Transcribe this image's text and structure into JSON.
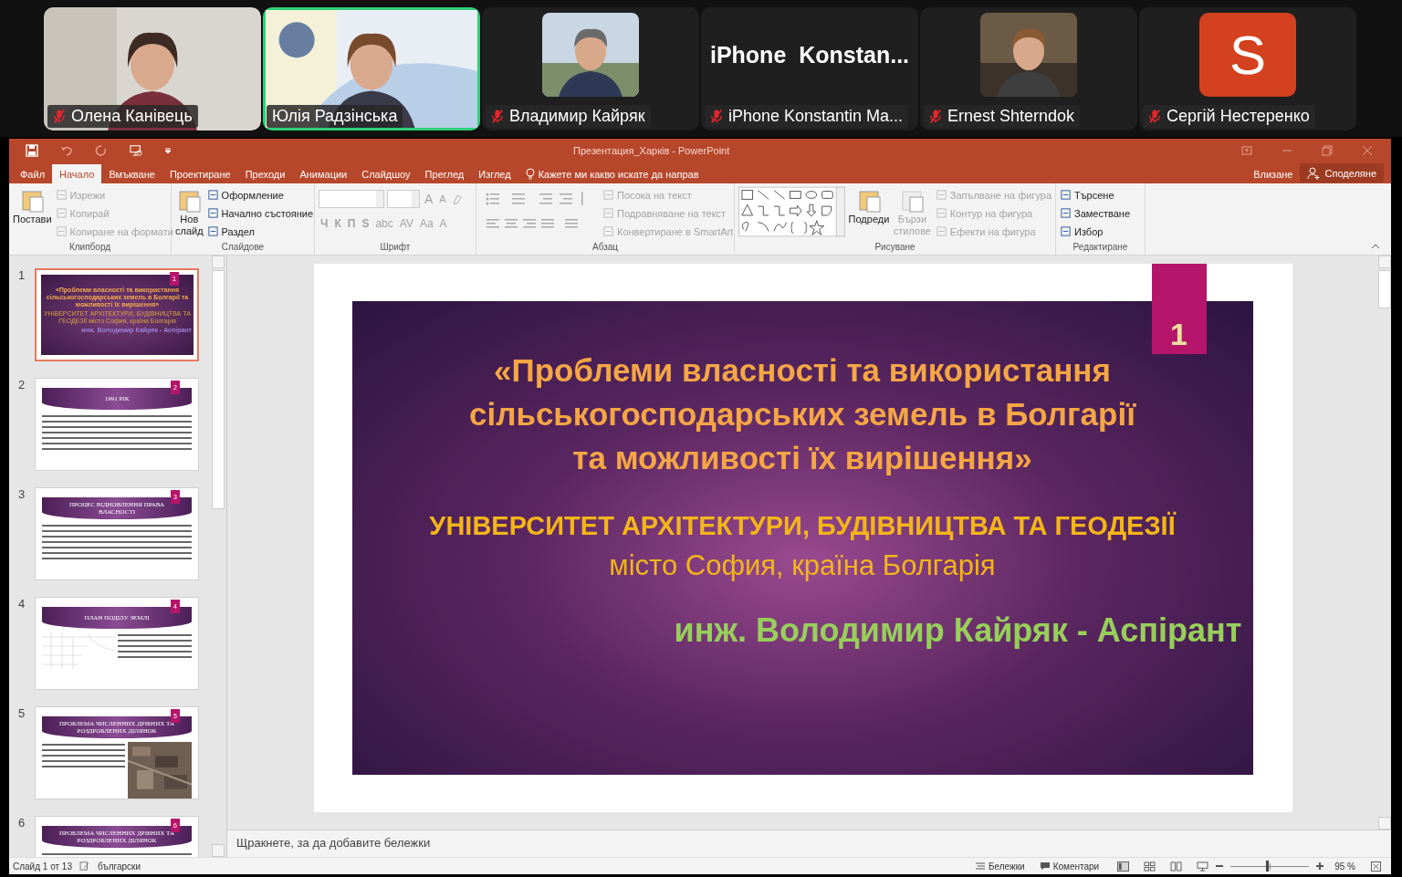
{
  "meeting": {
    "tiles": [
      {
        "name": "Олена Канівець",
        "muted": true,
        "speaking": false
      },
      {
        "name": "Юлія Радзінська",
        "muted": false,
        "speaking": true
      },
      {
        "kind": "avatar_photo",
        "name": "Владимир Кайряк",
        "muted": true,
        "speaking": false
      },
      {
        "kind": "name",
        "display": "iPhone  Konstan...",
        "name": "iPhone Konstantin Ma...",
        "muted": true,
        "speaking": false
      },
      {
        "kind": "avatar_photo",
        "name": "Ernest Shterndok",
        "muted": true,
        "speaking": false
      },
      {
        "kind": "letter",
        "letter": "S",
        "name": "Сергій Нестеренко",
        "muted": true,
        "speaking": false
      }
    ]
  },
  "window": {
    "title": "Презентация_Харків - PowerPoint"
  },
  "tabs": [
    {
      "label": "Файл",
      "selected": false
    },
    {
      "label": "Начало",
      "selected": true
    },
    {
      "label": "Вмъкване",
      "selected": false
    },
    {
      "label": "Проектиране",
      "selected": false
    },
    {
      "label": "Преходи",
      "selected": false
    },
    {
      "label": "Анимации",
      "selected": false
    },
    {
      "label": "Слайдшоу",
      "selected": false
    },
    {
      "label": "Преглед",
      "selected": false
    },
    {
      "label": "Изглед",
      "selected": false
    }
  ],
  "tell_me": "Кажете ми какво искате да направ",
  "sign_in": "Влизане",
  "share": "Споделяне",
  "ribbon": {
    "groups": [
      {
        "kind": "buttons",
        "label": "Клипборд",
        "big": [
          {
            "label": "Постави",
            "disabled": false
          }
        ],
        "small": [
          {
            "label": "Изрежи",
            "disabled": true
          },
          {
            "label": "Копирай",
            "disabled": true
          },
          {
            "label": "Копиране на формати",
            "disabled": true
          }
        ]
      },
      {
        "kind": "buttons",
        "label": "Слайдове",
        "big": [
          {
            "label": "Нов слайд",
            "disabled": false
          }
        ],
        "small": [
          {
            "label": "Оформление",
            "disabled": false
          },
          {
            "label": "Начално състояние",
            "disabled": false
          },
          {
            "label": "Раздел",
            "disabled": false
          }
        ]
      },
      {
        "kind": "font",
        "label": "Шрифт",
        "size_buttons": [
          "A",
          "A"
        ],
        "buttons": [
          "Ч",
          "К",
          "П",
          "S",
          "abc",
          "AV",
          "Aa",
          "A"
        ],
        "disabled": true
      },
      {
        "kind": "paragraph",
        "label": "Абзац",
        "small": [
          {
            "label": "Посока на текст",
            "disabled": true
          },
          {
            "label": "Подравняване на текст",
            "disabled": true
          },
          {
            "label": "Конвертиране в SmartArt",
            "disabled": true
          }
        ]
      },
      {
        "kind": "drawing",
        "label": "Рисуване",
        "big": [
          {
            "label": "Подреди",
            "disabled": false
          },
          {
            "label": "Бързи стилове",
            "disabled": true
          }
        ],
        "small": [
          {
            "label": "Запълване на фигура",
            "disabled": true
          },
          {
            "label": "Контур на фигура",
            "disabled": true
          },
          {
            "label": "Ефекти на фигура",
            "disabled": true
          }
        ]
      },
      {
        "kind": "buttons",
        "label": "Редактиране",
        "small": [
          {
            "label": "Търсене",
            "disabled": false
          },
          {
            "label": "Заместване",
            "disabled": false
          },
          {
            "label": "Избор",
            "disabled": false
          }
        ]
      }
    ]
  },
  "thumbnails": [
    {
      "number": "1",
      "tab_number": "1",
      "kind": "title",
      "selected": true,
      "title": "«Проблеми власності та використання сільськогосподарських земель в Болгарії та можливості їх вирішення»",
      "subtitle": "УНІВЕРСИТЕТ АРХІТЕКТУРИ, БУДІВНИЦТВА ТА  ГЕОДЕЗІЇ місто София, країна Болгарія",
      "author": "инж. Володимир Кайряк - Аспірант"
    },
    {
      "number": "2",
      "tab_number": "2",
      "kind": "text",
      "selected": false,
      "title": "1991 РІК"
    },
    {
      "number": "3",
      "tab_number": "3",
      "kind": "text",
      "selected": false,
      "title": "ПРОЦЕС ВІДНОВЛЕННЯ ПРАВА ВЛАСНОСТІ"
    },
    {
      "number": "4",
      "tab_number": "4",
      "kind": "map",
      "selected": false,
      "title": "ПЛАН ПОДІЛУ ЗЕМЛІ"
    },
    {
      "number": "5",
      "tab_number": "5",
      "selected": false,
      "title": "ПРОБЛЕМА ЧИСЛЕННИХ ДРІБНИХ ТА РОЗДРОБЛЕНИХ ДІЛЯНОК"
    },
    {
      "number": "6",
      "tab_number": "6",
      "kind": "text",
      "selected": false,
      "title": "ПРОБЛЕМА ЧИСЛЕННИХ ДРІБНИХ ТА РОЗДРОБЛЕНИХ ДІЛЯНОК"
    }
  ],
  "slide": {
    "number": "1",
    "title_lines": [
      "«Проблеми власності та використання",
      "сільськогосподарських земель в Болгарії",
      "та можливості їх вирішення»"
    ],
    "subtitle_lines": [
      "УНІВЕРСИТЕТ АРХІТЕКТУРИ, БУДІВНИЦТВА ТА ГЕОДЕЗІЇ",
      "місто София, країна Болгарія"
    ],
    "author": "инж. Володимир Кайряк - Аспірант"
  },
  "notes": {
    "placeholder": "Щракнете, за да добавите бележки"
  },
  "status_bar": {
    "slide": "Слайд 1 от 13",
    "language": "български",
    "notes": "Бележки",
    "comments": "Коментари",
    "zoom": {
      "level": 0.45
    },
    "zoom_label": "95 %"
  }
}
